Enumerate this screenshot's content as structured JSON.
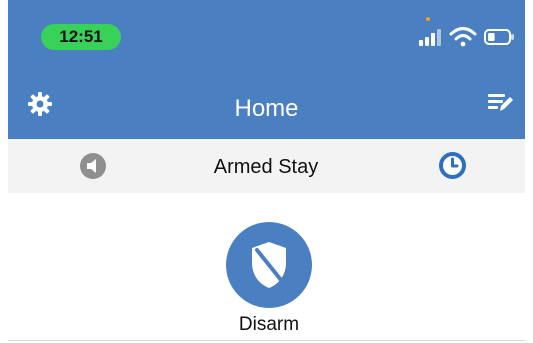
{
  "status_bar": {
    "time": "12:51",
    "signal_icon": "cellular-signal-icon",
    "wifi_icon": "wifi-icon",
    "battery_icon": "battery-icon",
    "battery_level": 0.35,
    "indicator_color": "#ff9d1f"
  },
  "header": {
    "title": "Home",
    "left_icon": "gear-icon",
    "right_icon": "edit-list-icon",
    "background": "#4a7fc1"
  },
  "armed_bar": {
    "left_icon": "speaker-icon",
    "status": "Armed Stay",
    "right_icon": "clock-icon",
    "background": "#f3f3f3"
  },
  "disarm": {
    "icon": "shield-icon",
    "label": "Disarm",
    "color": "#4a7fc1"
  },
  "colors": {
    "time_pill": "#38d15a",
    "accent": "#4a7fc1"
  }
}
